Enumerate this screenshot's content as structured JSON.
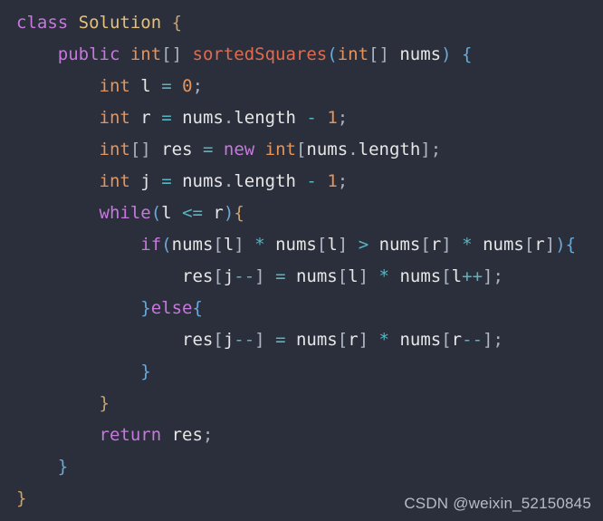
{
  "editor": {
    "background_color": "#2b2f3b",
    "language": "java",
    "font_size_px": 19,
    "line_height_px": 35
  },
  "colors": {
    "keyword": "#c678dd",
    "type": "#e5945b",
    "method": "#e06c4f",
    "variable": "#e6e6e6",
    "operator": "#56b6c2",
    "number": "#e5945b",
    "classname": "#e5c07b",
    "punctuation": "#abb2bf",
    "bracket_gold": "#c8a46a",
    "bracket_blue": "#6aa9d8",
    "watermark": "#b6bcc6",
    "background": "#2b2f3b"
  },
  "watermark": {
    "text": "CSDN @weixin_52150845"
  },
  "code": {
    "plain_text": "class Solution {\n    public int[] sortedSquares(int[] nums) {\n        int l = 0;\n        int r = nums.length - 1;\n        int[] res = new int[nums.length];\n        int j = nums.length - 1;\n        while(l <= r){\n            if(nums[l] * nums[l] > nums[r] * nums[r]){\n                res[j--] = nums[l] * nums[l++];\n            }else{\n                res[j--] = nums[r] * nums[r--];\n            }\n        }\n        return res;\n    }\n}",
    "lines": [
      [
        [
          "class ",
          "keyword"
        ],
        [
          "Solution",
          "classname"
        ],
        [
          " ",
          "plain"
        ],
        [
          "{",
          "bracket1"
        ]
      ],
      [
        [
          "    ",
          "plain"
        ],
        [
          "public ",
          "keyword"
        ],
        [
          "int",
          "type"
        ],
        [
          "[]",
          "punct"
        ],
        [
          " ",
          "plain"
        ],
        [
          "sortedSquares",
          "method"
        ],
        [
          "(",
          "paren"
        ],
        [
          "int",
          "type"
        ],
        [
          "[]",
          "punct"
        ],
        [
          " ",
          "plain"
        ],
        [
          "nums",
          "var"
        ],
        [
          ")",
          "paren"
        ],
        [
          " ",
          "plain"
        ],
        [
          "{",
          "bracket2"
        ]
      ],
      [
        [
          "        ",
          "plain"
        ],
        [
          "int",
          "type"
        ],
        [
          " ",
          "plain"
        ],
        [
          "l",
          "var"
        ],
        [
          " ",
          "plain"
        ],
        [
          "=",
          "operator"
        ],
        [
          " ",
          "plain"
        ],
        [
          "0",
          "number"
        ],
        [
          ";",
          "punct"
        ]
      ],
      [
        [
          "        ",
          "plain"
        ],
        [
          "int",
          "type"
        ],
        [
          " ",
          "plain"
        ],
        [
          "r",
          "var"
        ],
        [
          " ",
          "plain"
        ],
        [
          "=",
          "operator"
        ],
        [
          " ",
          "plain"
        ],
        [
          "nums",
          "var"
        ],
        [
          ".",
          "punct"
        ],
        [
          "length",
          "var"
        ],
        [
          " ",
          "plain"
        ],
        [
          "-",
          "operator"
        ],
        [
          " ",
          "plain"
        ],
        [
          "1",
          "number"
        ],
        [
          ";",
          "punct"
        ]
      ],
      [
        [
          "        ",
          "plain"
        ],
        [
          "int",
          "type"
        ],
        [
          "[]",
          "punct"
        ],
        [
          " ",
          "plain"
        ],
        [
          "res",
          "var"
        ],
        [
          " ",
          "plain"
        ],
        [
          "=",
          "operator"
        ],
        [
          " ",
          "plain"
        ],
        [
          "new ",
          "keyword"
        ],
        [
          "int",
          "type"
        ],
        [
          "[",
          "bracket3"
        ],
        [
          "nums",
          "var"
        ],
        [
          ".",
          "punct"
        ],
        [
          "length",
          "var"
        ],
        [
          "]",
          "bracket3"
        ],
        [
          ";",
          "punct"
        ]
      ],
      [
        [
          "        ",
          "plain"
        ],
        [
          "int",
          "type"
        ],
        [
          " ",
          "plain"
        ],
        [
          "j",
          "var"
        ],
        [
          " ",
          "plain"
        ],
        [
          "=",
          "operator"
        ],
        [
          " ",
          "plain"
        ],
        [
          "nums",
          "var"
        ],
        [
          ".",
          "punct"
        ],
        [
          "length",
          "var"
        ],
        [
          " ",
          "plain"
        ],
        [
          "-",
          "operator"
        ],
        [
          " ",
          "plain"
        ],
        [
          "1",
          "number"
        ],
        [
          ";",
          "punct"
        ]
      ],
      [
        [
          "        ",
          "plain"
        ],
        [
          "while",
          "keyword"
        ],
        [
          "(",
          "paren"
        ],
        [
          "l",
          "var"
        ],
        [
          " ",
          "plain"
        ],
        [
          "<=",
          "operator"
        ],
        [
          " ",
          "plain"
        ],
        [
          "r",
          "var"
        ],
        [
          ")",
          "paren"
        ],
        [
          "{",
          "bracket1"
        ]
      ],
      [
        [
          "            ",
          "plain"
        ],
        [
          "if",
          "keyword"
        ],
        [
          "(",
          "paren"
        ],
        [
          "nums",
          "var"
        ],
        [
          "[",
          "bracket3"
        ],
        [
          "l",
          "var"
        ],
        [
          "]",
          "bracket3"
        ],
        [
          " ",
          "plain"
        ],
        [
          "*",
          "operator"
        ],
        [
          " ",
          "plain"
        ],
        [
          "nums",
          "var"
        ],
        [
          "[",
          "bracket3"
        ],
        [
          "l",
          "var"
        ],
        [
          "]",
          "bracket3"
        ],
        [
          " ",
          "plain"
        ],
        [
          ">",
          "operator"
        ],
        [
          " ",
          "plain"
        ],
        [
          "nums",
          "var"
        ],
        [
          "[",
          "bracket3"
        ],
        [
          "r",
          "var"
        ],
        [
          "]",
          "bracket3"
        ],
        [
          " ",
          "plain"
        ],
        [
          "*",
          "operator"
        ],
        [
          " ",
          "plain"
        ],
        [
          "nums",
          "var"
        ],
        [
          "[",
          "bracket3"
        ],
        [
          "r",
          "var"
        ],
        [
          "]",
          "bracket3"
        ],
        [
          ")",
          "paren"
        ],
        [
          "{",
          "bracket2"
        ]
      ],
      [
        [
          "                ",
          "plain"
        ],
        [
          "res",
          "var"
        ],
        [
          "[",
          "bracket3"
        ],
        [
          "j",
          "var"
        ],
        [
          "--",
          "operator"
        ],
        [
          "]",
          "bracket3"
        ],
        [
          " ",
          "plain"
        ],
        [
          "=",
          "operator"
        ],
        [
          " ",
          "plain"
        ],
        [
          "nums",
          "var"
        ],
        [
          "[",
          "bracket3"
        ],
        [
          "l",
          "var"
        ],
        [
          "]",
          "bracket3"
        ],
        [
          " ",
          "plain"
        ],
        [
          "*",
          "operator"
        ],
        [
          " ",
          "plain"
        ],
        [
          "nums",
          "var"
        ],
        [
          "[",
          "bracket3"
        ],
        [
          "l",
          "var"
        ],
        [
          "++",
          "operator"
        ],
        [
          "]",
          "bracket3"
        ],
        [
          ";",
          "punct"
        ]
      ],
      [
        [
          "            ",
          "plain"
        ],
        [
          "}",
          "bracket2"
        ],
        [
          "else",
          "keyword"
        ],
        [
          "{",
          "bracket2"
        ]
      ],
      [
        [
          "                ",
          "plain"
        ],
        [
          "res",
          "var"
        ],
        [
          "[",
          "bracket3"
        ],
        [
          "j",
          "var"
        ],
        [
          "--",
          "operator"
        ],
        [
          "]",
          "bracket3"
        ],
        [
          " ",
          "plain"
        ],
        [
          "=",
          "operator"
        ],
        [
          " ",
          "plain"
        ],
        [
          "nums",
          "var"
        ],
        [
          "[",
          "bracket3"
        ],
        [
          "r",
          "var"
        ],
        [
          "]",
          "bracket3"
        ],
        [
          " ",
          "plain"
        ],
        [
          "*",
          "operator"
        ],
        [
          " ",
          "plain"
        ],
        [
          "nums",
          "var"
        ],
        [
          "[",
          "bracket3"
        ],
        [
          "r",
          "var"
        ],
        [
          "--",
          "operator"
        ],
        [
          "]",
          "bracket3"
        ],
        [
          ";",
          "punct"
        ]
      ],
      [
        [
          "            ",
          "plain"
        ],
        [
          "}",
          "bracket2"
        ]
      ],
      [
        [
          "        ",
          "plain"
        ],
        [
          "}",
          "bracket1"
        ]
      ],
      [
        [
          "        ",
          "plain"
        ],
        [
          "return ",
          "keyword"
        ],
        [
          "res",
          "var"
        ],
        [
          ";",
          "punct"
        ]
      ],
      [
        [
          "    ",
          "plain"
        ],
        [
          "}",
          "bracket2"
        ]
      ],
      [
        [
          "}",
          "bracket1"
        ]
      ]
    ]
  }
}
